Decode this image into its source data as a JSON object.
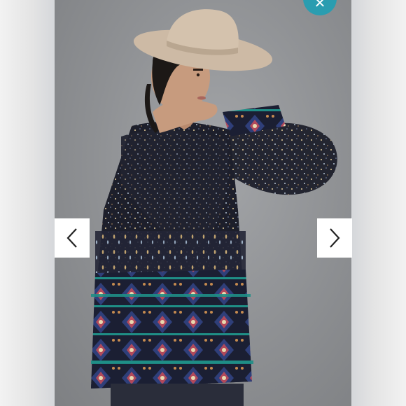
{
  "viewer": {
    "image_subject": "woman-in-hat-wearing-printed-sheer-blouse",
    "accent_color": "#2a9db0"
  },
  "controls": {
    "close_icon": "close-icon",
    "prev_icon": "chevron-left-icon",
    "next_icon": "chevron-right-icon"
  }
}
